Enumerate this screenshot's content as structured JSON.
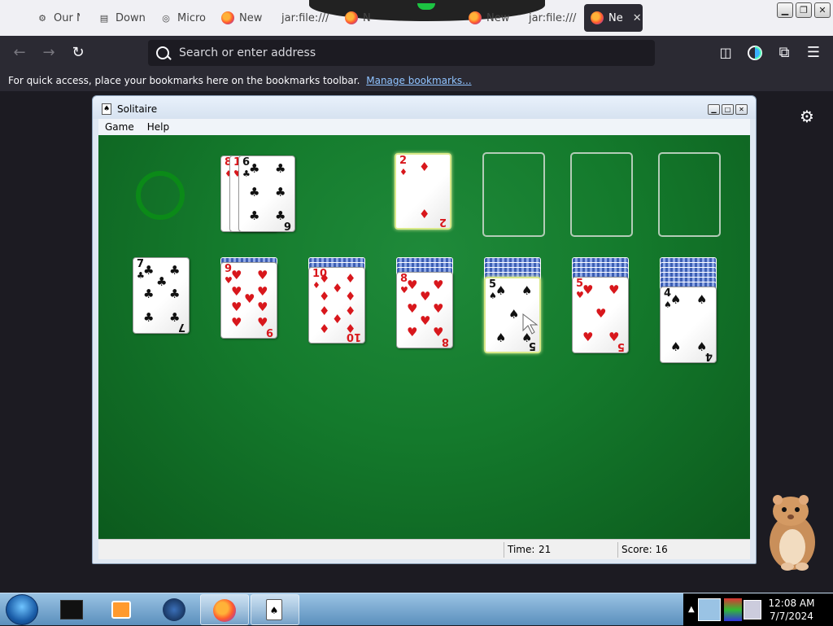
{
  "browser": {
    "tabs": [
      {
        "label": "Our N",
        "icon": "gear-icon"
      },
      {
        "label": "Down",
        "icon": "page-icon"
      },
      {
        "label": "Micro",
        "icon": "target-icon"
      },
      {
        "label": "New",
        "icon": "firefox-icon"
      },
      {
        "label": "jar:file:///",
        "icon": "none"
      },
      {
        "label": "N",
        "icon": "firefox-icon"
      },
      {
        "label": "New",
        "icon": "firefox-icon"
      },
      {
        "label": "jar:file:///",
        "icon": "none"
      },
      {
        "label": "Ne",
        "icon": "firefox-icon",
        "active": true
      }
    ],
    "close_tab_glyph": "✕",
    "url_placeholder": "Search or enter address",
    "bookmarks_message": "For quick access, place your bookmarks here on the bookmarks toolbar.",
    "manage_bookmarks_label": "Manage bookmarks..."
  },
  "solitaire": {
    "title": "Solitaire",
    "menu": [
      "Game",
      "Help"
    ],
    "status": {
      "time_label": "Time:",
      "time_value": "21",
      "score_label": "Score: 16"
    },
    "stock_empty": true,
    "waste": [
      {
        "rank": "8",
        "suit": "♦",
        "color": "red"
      },
      {
        "rank": "10",
        "suit": "♥",
        "color": "red"
      },
      {
        "rank": "6",
        "suit": "♣",
        "color": "black"
      }
    ],
    "foundations": [
      {
        "rank": "2",
        "suit": "♦",
        "color": "red"
      },
      null,
      null,
      null
    ],
    "tableau": [
      {
        "hidden": 0,
        "top": {
          "rank": "7",
          "suit": "♣",
          "color": "black"
        }
      },
      {
        "hidden": 1,
        "top": {
          "rank": "9",
          "suit": "♥",
          "color": "red"
        }
      },
      {
        "hidden": 2,
        "top": {
          "rank": "10",
          "suit": "♦",
          "color": "red"
        }
      },
      {
        "hidden": 3,
        "top": {
          "rank": "8",
          "suit": "♥",
          "color": "red"
        }
      },
      {
        "hidden": 4,
        "top": {
          "rank": "5",
          "suit": "♠",
          "color": "black"
        },
        "highlighted": true
      },
      {
        "hidden": 4,
        "top": {
          "rank": "5",
          "suit": "♥",
          "color": "red"
        }
      },
      {
        "hidden": 6,
        "top": {
          "rank": "4",
          "suit": "♠",
          "color": "black"
        }
      }
    ]
  },
  "taskbar": {
    "clock_time": "12:08 AM",
    "clock_date": "7/7/2024"
  }
}
